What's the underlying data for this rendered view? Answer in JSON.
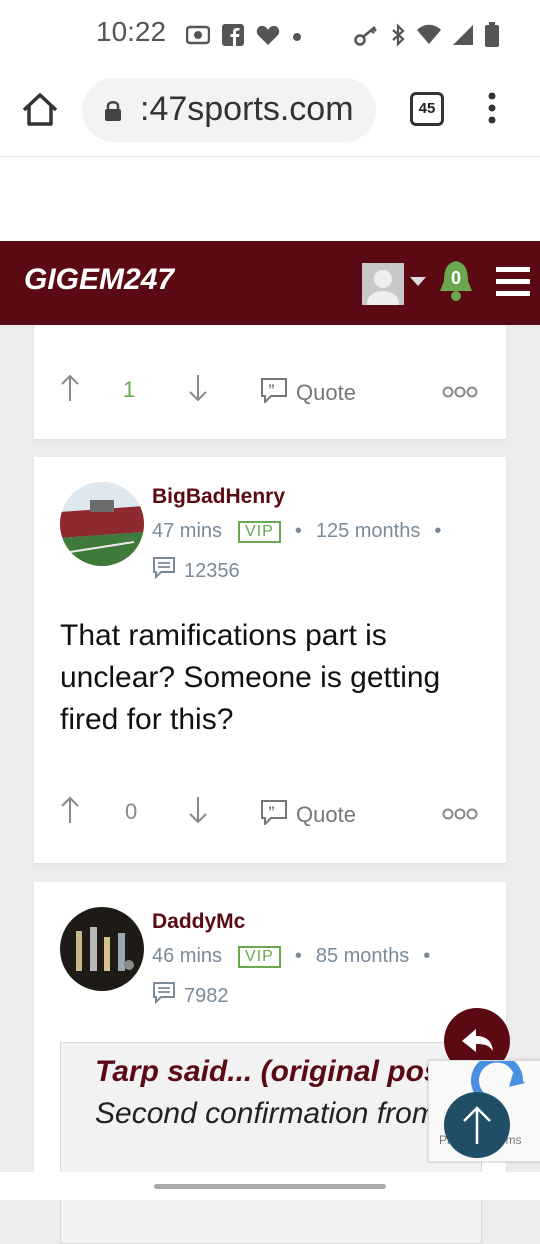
{
  "status_bar": {
    "time": "10:22"
  },
  "browser": {
    "url": ":47sports.com",
    "tab_count": "45"
  },
  "site": {
    "logo_text": "GIGEM247",
    "notification_count": "0"
  },
  "post_top": {
    "upvotes": "1",
    "quote_label": "Quote"
  },
  "post_1": {
    "username": "BigBadHenry",
    "time_ago": "47 mins",
    "badge": "VIP",
    "tenure": "125 months",
    "post_count": "12356",
    "body": "That ramifications part is unclear? Someone is getting fired for this?",
    "upvotes": "0",
    "quote_label": "Quote"
  },
  "post_2": {
    "username": "DaddyMc",
    "time_ago": "46 mins",
    "badge": "VIP",
    "tenure": "85 months",
    "post_count": "7982",
    "quote_author": "Tarp said... (",
    "quote_link": "original post",
    "quote_close": ")",
    "quote_text": " Second confirmation from"
  },
  "recaptcha": {
    "text": "Privacy - Terms"
  },
  "colors": {
    "brand": "#5b0a14",
    "accent_green": "#6aa84f",
    "fab_blue": "#1f4e66"
  }
}
